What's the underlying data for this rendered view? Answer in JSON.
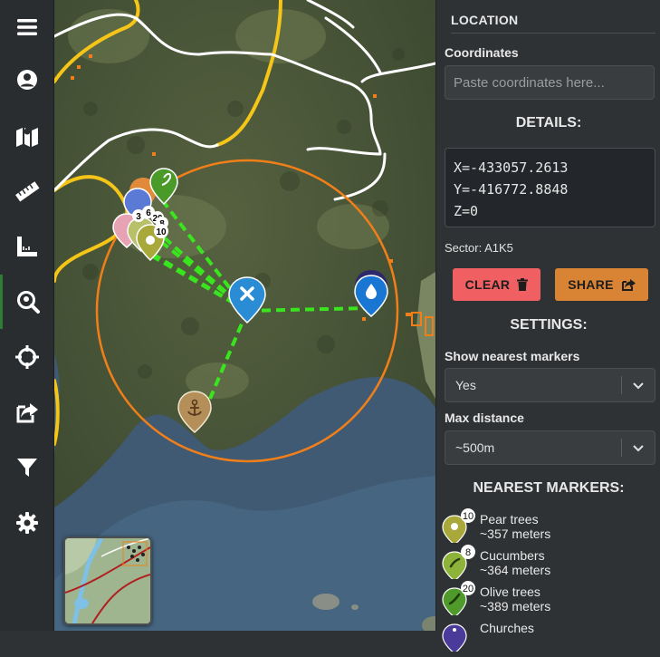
{
  "toolbar": {
    "icons": [
      "menu-icon",
      "user-icon",
      "map-icon",
      "ruler-icon",
      "measure-angle-icon",
      "search-location-icon",
      "crosshairs-icon",
      "share-icon",
      "filter-icon",
      "gear-icon"
    ]
  },
  "map": {
    "markers": [
      {
        "name": "water-marker",
        "color": "#1976d2"
      },
      {
        "name": "anchor-marker",
        "color": "#b58f5a"
      },
      {
        "name": "selected-location-marker",
        "color": "#2b8cd6"
      }
    ],
    "marker_counts": [
      "3",
      "6",
      "20",
      "8",
      "10"
    ],
    "search_radius_color": "#f07f1a",
    "nearest_line_color": "#39e61e"
  },
  "panel": {
    "location_heading": "LOCATION",
    "coordinates_label": "Coordinates",
    "coordinates_placeholder": "Paste coordinates here...",
    "details_title": "DETAILS:",
    "x_line": "X=-433057.2613",
    "y_line": "Y=-416772.8848",
    "z_line": "Z=0",
    "sector": "Sector: A1K5",
    "clear_label": "CLEAR",
    "share_label": "SHARE",
    "settings_title": "SETTINGS:",
    "show_nearest_label": "Show nearest markers",
    "show_nearest_value": "Yes",
    "max_distance_label": "Max distance",
    "max_distance_value": "~500m",
    "nearest_title": "NEAREST MARKERS:",
    "nearest": [
      {
        "name": "Pear trees",
        "distance": "~357 meters",
        "count": "10",
        "color": "#a9a83a"
      },
      {
        "name": "Cucumbers",
        "distance": "~364 meters",
        "count": "8",
        "color": "#8db33a"
      },
      {
        "name": "Olive trees",
        "distance": "~389 meters",
        "count": "20",
        "color": "#4f9a2a"
      },
      {
        "name": "Churches",
        "distance": "",
        "count": "",
        "color": "#4a3a9a"
      }
    ]
  }
}
